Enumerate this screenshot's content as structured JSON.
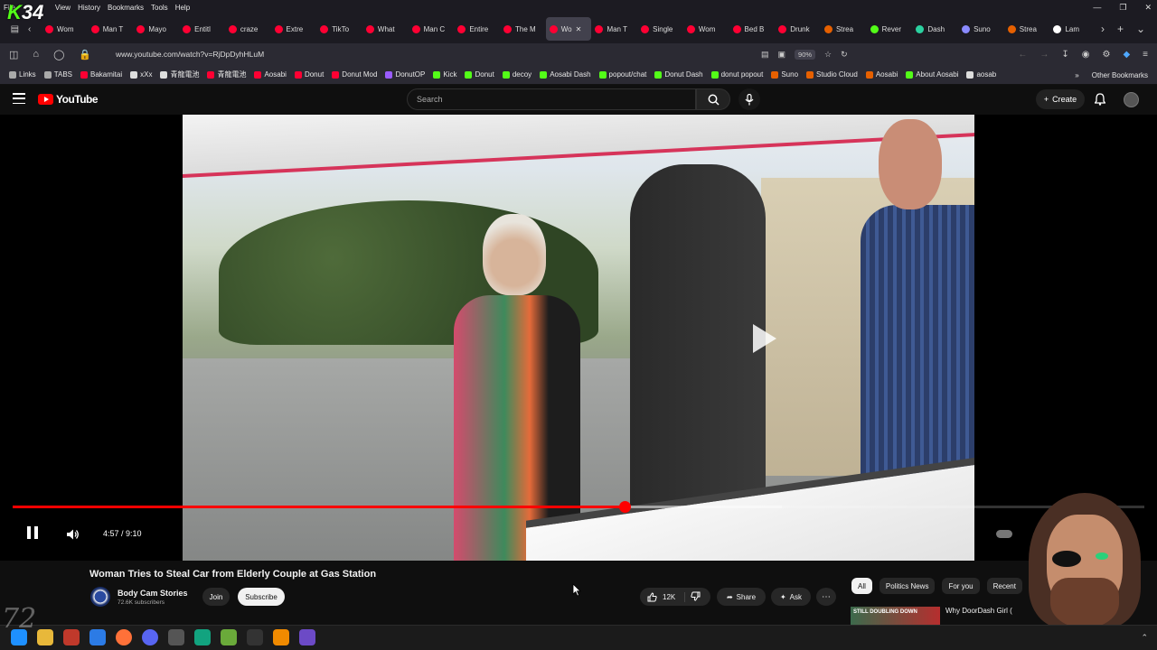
{
  "overlay": {
    "logo_letter": "K",
    "logo_number": "34",
    "watermark": "72"
  },
  "browser": {
    "menu": [
      "File",
      "View",
      "History",
      "Bookmarks",
      "Tools",
      "Help"
    ],
    "tabs": [
      {
        "label": "Wom",
        "color": "#ff0033"
      },
      {
        "label": "Man T",
        "color": "#ff0033"
      },
      {
        "label": "Mayo",
        "color": "#ff0033"
      },
      {
        "label": "Entitl",
        "color": "#ff0033"
      },
      {
        "label": "craze",
        "color": "#ff0033"
      },
      {
        "label": "Extre",
        "color": "#ff0033"
      },
      {
        "label": "TikTo",
        "color": "#ff0033"
      },
      {
        "label": "What",
        "color": "#ff0033"
      },
      {
        "label": "Man C",
        "color": "#ff0033"
      },
      {
        "label": "Entire",
        "color": "#ff0033"
      },
      {
        "label": "The M",
        "color": "#ff0033"
      },
      {
        "label": "Wo",
        "color": "#ff0033",
        "active": true
      },
      {
        "label": "Man T",
        "color": "#ff0033"
      },
      {
        "label": "Single",
        "color": "#ff0033"
      },
      {
        "label": "Wom",
        "color": "#ff0033"
      },
      {
        "label": "Bed B",
        "color": "#ff0033"
      },
      {
        "label": "Drunk",
        "color": "#ff0033"
      },
      {
        "label": "Strea",
        "color": "#e66000"
      },
      {
        "label": "Rever",
        "color": "#53fc18"
      },
      {
        "label": "Dash",
        "color": "#2bd1a0"
      },
      {
        "label": "Suno",
        "color": "#8a8aff"
      },
      {
        "label": "Strea",
        "color": "#e66000"
      },
      {
        "label": "Lam",
        "color": "#ffffff"
      }
    ],
    "url": "www.youtube.com/watch?v=RjDpDyhHLuM",
    "zoom": "90%",
    "bookmarks": [
      {
        "label": "Links",
        "color": "#aaaaaa"
      },
      {
        "label": "TABS",
        "color": "#aaaaaa"
      },
      {
        "label": "Bakamitai",
        "color": "#ff0033"
      },
      {
        "label": "xXx",
        "color": "#dddddd"
      },
      {
        "label": "青龍電池",
        "color": "#dddddd"
      },
      {
        "label": "青龍電池",
        "color": "#ff0033"
      },
      {
        "label": "Aosabi",
        "color": "#ff0033"
      },
      {
        "label": "Donut",
        "color": "#ff0033"
      },
      {
        "label": "Donut Mod",
        "color": "#ff0033"
      },
      {
        "label": "DonutOP",
        "color": "#9a5cff"
      },
      {
        "label": "Kick",
        "color": "#53fc18"
      },
      {
        "label": "Donut",
        "color": "#53fc18"
      },
      {
        "label": "decoy",
        "color": "#53fc18"
      },
      {
        "label": "Aosabi Dash",
        "color": "#53fc18"
      },
      {
        "label": "popout/chat",
        "color": "#53fc18"
      },
      {
        "label": "Donut Dash",
        "color": "#53fc18"
      },
      {
        "label": "donut popout",
        "color": "#53fc18"
      },
      {
        "label": "Suno",
        "color": "#e66000"
      },
      {
        "label": "Studio Cloud",
        "color": "#e66000"
      },
      {
        "label": "Aosabi",
        "color": "#e66000"
      },
      {
        "label": "About Aosabi",
        "color": "#53fc18"
      },
      {
        "label": "aosab",
        "color": "#dddddd"
      }
    ],
    "other_bookmarks": "Other Bookmarks"
  },
  "youtube": {
    "logo": "YouTube",
    "search_placeholder": "Search",
    "create_label": "Create",
    "player": {
      "time_current": "4:57",
      "time_total": "9:10",
      "time_display": "4:57 / 9:10",
      "progress": 0.541,
      "buffered": 0.68
    },
    "video": {
      "title": "Woman Tries to Steal Car from Elderly Couple at Gas Station",
      "channel": "Body Cam Stories",
      "subscribers": "72.6K subscribers",
      "join": "Join",
      "subscribe": "Subscribe",
      "likes": "12K",
      "share": "Share",
      "ask": "Ask"
    },
    "chips": [
      "All",
      "Politics News",
      "For you",
      "Recent"
    ],
    "recommended": {
      "title": "Why DoorDash Girl (",
      "thumb_text": "STILL DOUBLING DOWN"
    }
  }
}
